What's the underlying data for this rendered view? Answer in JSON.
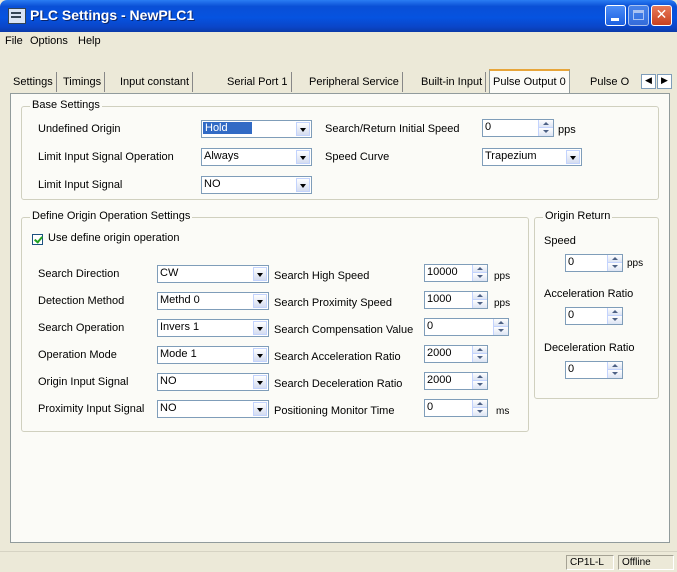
{
  "window": {
    "title": "PLC Settings - NewPLC1"
  },
  "menu": [
    "File",
    "Options",
    "Help"
  ],
  "tabs": [
    "Settings",
    "Timings",
    "Input constant",
    "Serial Port 1",
    "Peripheral Service",
    "Built-in Input",
    "Pulse Output 0",
    "Pulse O"
  ],
  "base_settings": {
    "title": "Base Settings",
    "undefined_origin": {
      "label": "Undefined Origin",
      "value": "Hold"
    },
    "limit_input_signal_operation": {
      "label": "Limit Input Signal Operation",
      "value": "Always"
    },
    "limit_input_signal": {
      "label": "Limit Input Signal",
      "value": "NO"
    },
    "search_return_initial_speed": {
      "label": "Search/Return Initial Speed",
      "value": "0",
      "unit": "pps"
    },
    "speed_curve": {
      "label": "Speed Curve",
      "value": "Trapezium"
    }
  },
  "origin_settings": {
    "title": "Define Origin Operation Settings",
    "use_define_origin": "Use define origin operation",
    "search_direction": {
      "label": "Search Direction",
      "value": "CW"
    },
    "detection_method": {
      "label": "Detection Method",
      "value": "Methd 0"
    },
    "search_operation": {
      "label": "Search Operation",
      "value": "Invers 1"
    },
    "operation_mode": {
      "label": "Operation Mode",
      "value": "Mode 1"
    },
    "origin_input_signal": {
      "label": "Origin Input Signal",
      "value": "NO"
    },
    "proximity_input_signal": {
      "label": "Proximity Input Signal",
      "value": "NO"
    },
    "search_high_speed": {
      "label": "Search High Speed",
      "value": "10000",
      "unit": "pps"
    },
    "search_proximity_speed": {
      "label": "Search Proximity Speed",
      "value": "1000",
      "unit": "pps"
    },
    "search_compensation_value": {
      "label": "Search Compensation Value",
      "value": "0"
    },
    "search_acceleration_ratio": {
      "label": "Search Acceleration Ratio",
      "value": "2000"
    },
    "search_deceleration_ratio": {
      "label": "Search Deceleration Ratio",
      "value": "2000"
    },
    "positioning_monitor_time": {
      "label": "Positioning Monitor Time",
      "value": "0",
      "unit": "ms"
    }
  },
  "origin_return": {
    "title": "Origin Return",
    "speed": {
      "label": "Speed",
      "value": "0",
      "unit": "pps"
    },
    "acceleration_ratio": {
      "label": "Acceleration Ratio",
      "value": "0"
    },
    "deceleration_ratio": {
      "label": "Deceleration Ratio",
      "value": "0"
    }
  },
  "status": {
    "model": "CP1L-L",
    "state": "Offline"
  }
}
